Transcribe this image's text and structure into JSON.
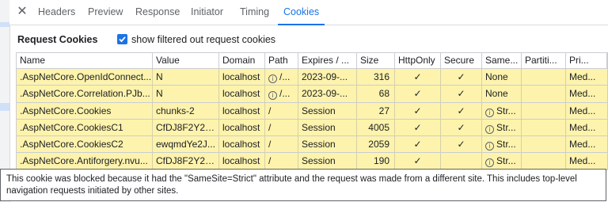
{
  "tabs": [
    {
      "label": "Headers"
    },
    {
      "label": "Preview"
    },
    {
      "label": "Response"
    },
    {
      "label": "Initiator"
    },
    {
      "label": "Timing"
    },
    {
      "label": "Cookies",
      "active": true
    }
  ],
  "section": {
    "title": "Request Cookies",
    "checkbox_label": "show filtered out request cookies",
    "checkbox_checked": true
  },
  "table": {
    "columns": [
      "Name",
      "Value",
      "Domain",
      "Path",
      "Expires / ...",
      "Size",
      "HttpOnly",
      "Secure",
      "Same...",
      "Partiti...",
      "Pri..."
    ],
    "rows": [
      {
        "name": ".AspNetCore.OpenIdConnect...",
        "value": "N",
        "domain": "localhost",
        "path": "/...",
        "path_info": true,
        "expires": "2023-09-...",
        "size": "316",
        "httponly": "✓",
        "secure": "✓",
        "samesite": "None",
        "samesite_info": false,
        "partition": "",
        "priority": "Med..."
      },
      {
        "name": ".AspNetCore.Correlation.PJb...",
        "value": "N",
        "domain": "localhost",
        "path": "/...",
        "path_info": true,
        "expires": "2023-09-...",
        "size": "68",
        "httponly": "✓",
        "secure": "✓",
        "samesite": "None",
        "samesite_info": false,
        "partition": "",
        "priority": "Med..."
      },
      {
        "name": ".AspNetCore.Cookies",
        "value": "chunks-2",
        "domain": "localhost",
        "path": "/",
        "path_info": false,
        "expires": "Session",
        "size": "27",
        "httponly": "✓",
        "secure": "✓",
        "samesite": "Str...",
        "samesite_info": true,
        "partition": "",
        "priority": "Med..."
      },
      {
        "name": ".AspNetCore.CookiesC1",
        "value": "CfDJ8F2Y2K...",
        "domain": "localhost",
        "path": "/",
        "path_info": false,
        "expires": "Session",
        "size": "4005",
        "httponly": "✓",
        "secure": "✓",
        "samesite": "Str...",
        "samesite_info": true,
        "partition": "",
        "priority": "Med..."
      },
      {
        "name": ".AspNetCore.CookiesC2",
        "value": "ewqmdYe2J...",
        "domain": "localhost",
        "path": "/",
        "path_info": false,
        "expires": "Session",
        "size": "2059",
        "httponly": "✓",
        "secure": "✓",
        "samesite": "Str...",
        "samesite_info": true,
        "partition": "",
        "priority": "Med..."
      },
      {
        "name": ".AspNetCore.Antiforgery.nvu...",
        "value": "CfDJ8F2Y2K...",
        "domain": "localhost",
        "path": "/",
        "path_info": false,
        "expires": "Session",
        "size": "190",
        "httponly": "✓",
        "secure": "",
        "samesite": "Str...",
        "samesite_info": true,
        "partition": "",
        "priority": "Med..."
      }
    ]
  },
  "tooltip": "This cookie was blocked because it had the \"SameSite=Strict\" attribute and the request was made from a different site. This includes top-level navigation requests initiated by other sites.",
  "colors": {
    "accent": "#1a73e8",
    "blocked_row": "#fdf3ad"
  }
}
